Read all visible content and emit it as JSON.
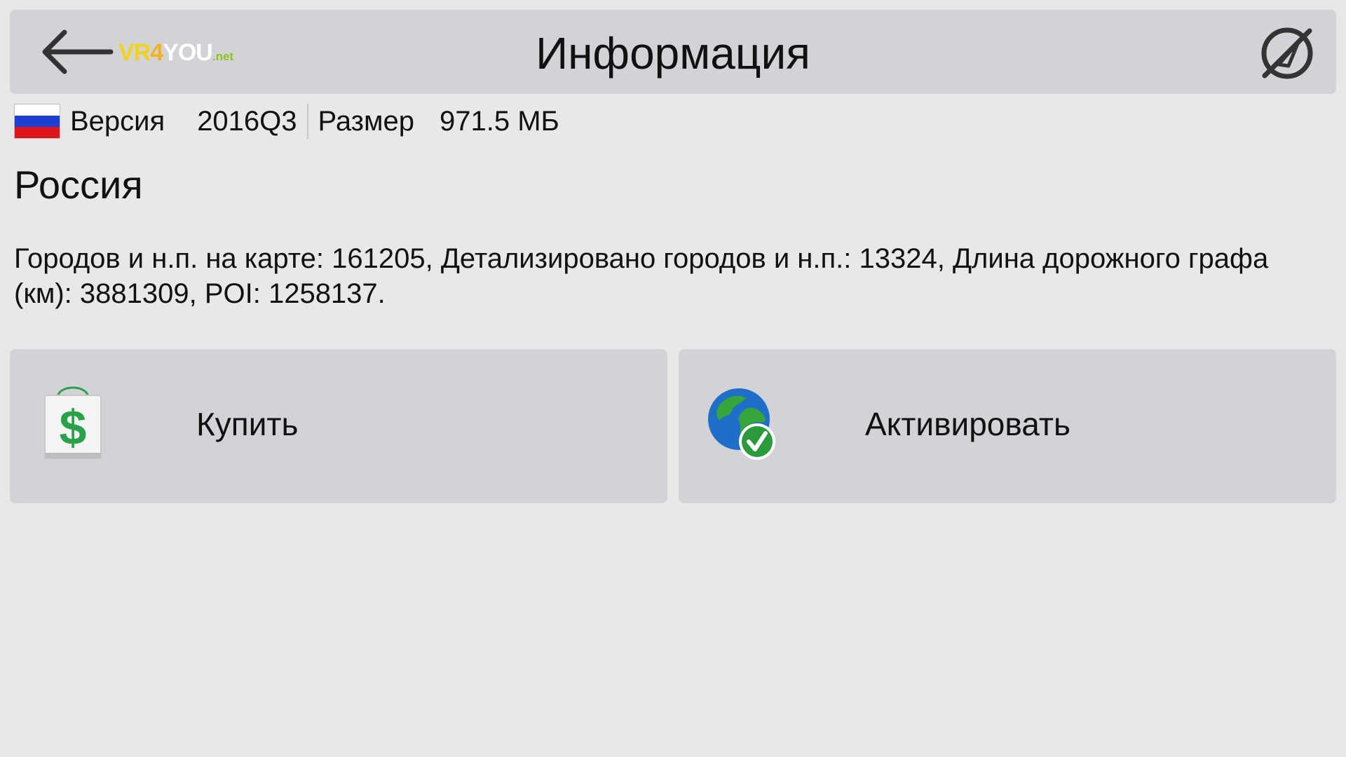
{
  "header": {
    "title": "Информация",
    "logo": {
      "part1": "VR",
      "part2": "4",
      "part3": "YOU",
      "part4": ".net"
    },
    "back_icon": "arrow-left-icon",
    "gps_icon": "gps-off-icon"
  },
  "map_info": {
    "flag": "russia-flag",
    "flag_colors": [
      "#ffffff",
      "#1c3fd0",
      "#e0141b"
    ],
    "version_label": "Версия",
    "version_value": "2016Q3",
    "size_label": "Размер",
    "size_value": "971.5 МБ"
  },
  "country": "Россия",
  "description": "Городов и н.п. на карте: 161205, Детализировано городов и н.п.: 13324, Длина дорожного графа (км): 3881309, POI: 1258137.",
  "buttons": {
    "buy": {
      "label": "Купить",
      "icon": "shopping-bag-dollar-icon"
    },
    "activate": {
      "label": "Активировать",
      "icon": "globe-check-icon"
    }
  },
  "colors": {
    "background": "#e8e8e8",
    "panel": "#d2d3d6",
    "dollar_green": "#2aa24a"
  }
}
